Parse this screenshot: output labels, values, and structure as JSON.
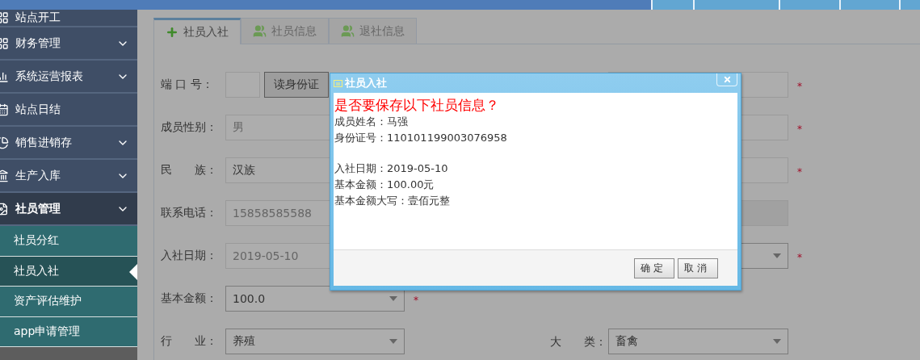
{
  "sidebar": {
    "items": [
      {
        "label": "站点开工",
        "kind": "link",
        "expanded": false
      },
      {
        "label": "财务管理",
        "kind": "group",
        "expanded": false
      },
      {
        "label": "系统运营报表",
        "kind": "group",
        "expanded": false
      },
      {
        "label": "站点日结",
        "kind": "link",
        "expanded": false
      },
      {
        "label": "销售进销存",
        "kind": "group",
        "expanded": false
      },
      {
        "label": "生产入库",
        "kind": "group",
        "expanded": false
      },
      {
        "label": "社员管理",
        "kind": "group",
        "expanded": true,
        "children": [
          {
            "label": "社员分红",
            "selected": false
          },
          {
            "label": "社员入社",
            "selected": true
          },
          {
            "label": "资产评估维护",
            "selected": false
          },
          {
            "label": "app申请管理",
            "selected": false
          }
        ]
      }
    ]
  },
  "tabs": [
    {
      "label": "社员入社",
      "selected": true
    },
    {
      "label": "社员信息",
      "selected": false
    },
    {
      "label": "退社信息",
      "selected": false
    }
  ],
  "form": {
    "rows": [
      {
        "left": {
          "label": "端 口 号：",
          "kind": "port",
          "button": "读身份证"
        },
        "right": {
          "kind": "text",
          "mark": "*"
        }
      },
      {
        "left": {
          "label": "成员性别：",
          "kind": "text",
          "value": "男",
          "readonly": true
        },
        "right": {
          "kind": "text",
          "mark": "*"
        }
      },
      {
        "left": {
          "label": "民　　族：",
          "kind": "text",
          "value": "汉族",
          "readonly": false
        },
        "right": {
          "kind": "text",
          "mark": "*"
        }
      },
      {
        "left": {
          "label": "联系电话：",
          "kind": "text",
          "value": "15858585588",
          "readonly": true
        },
        "right": {
          "kind": "text",
          "disabled": true
        }
      },
      {
        "left": {
          "label": "入社日期：",
          "kind": "text",
          "value": "2019-05-10",
          "readonly": true
        },
        "right": {
          "kind": "select",
          "mark": "*"
        }
      },
      {
        "left": {
          "label": "基本金额：",
          "kind": "select",
          "value": "100.0",
          "readonly": false,
          "mark": "*"
        }
      },
      {
        "left": {
          "label": "行　　业：",
          "kind": "select",
          "value": "养殖",
          "readonly": false
        },
        "right": {
          "label": "大　　类：",
          "kind": "select",
          "value": "畜禽",
          "readonly": false
        }
      }
    ]
  },
  "dialog": {
    "title": "社员入社",
    "heading": "是否要保存以下社员信息？",
    "line_groups": [
      [
        "成员姓名：马强",
        "身份证号：110101199003076958"
      ],
      [
        "入社日期：2019-05-10",
        "基本金额：100.00元",
        "基本金额大写：壹佰元整"
      ]
    ],
    "buttons": [
      "确定",
      "取消"
    ]
  }
}
